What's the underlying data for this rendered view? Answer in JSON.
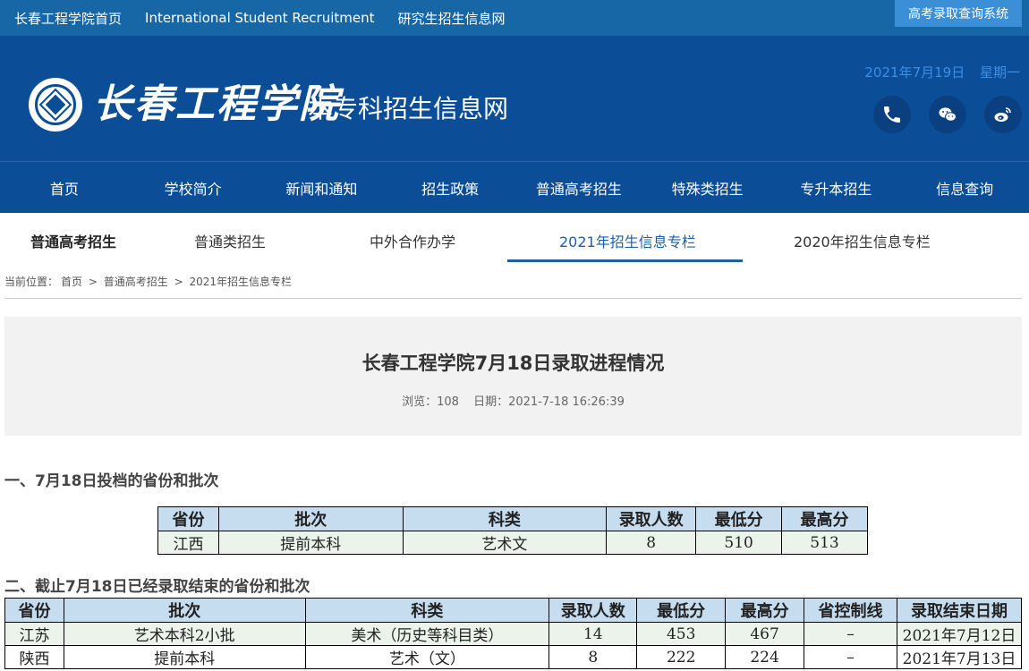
{
  "topbar": {
    "links": [
      "长春工程学院首页",
      "International Student Recruitment",
      "研究生招生信息网"
    ],
    "system_button": "高考录取查询系统"
  },
  "header": {
    "brand_calligraphy": "长春工程学院",
    "brand_sub": "本专科招生信息网",
    "date": "2021年7月19日",
    "weekday": "星期一",
    "social_icons": [
      "phone-icon",
      "wechat-icon",
      "weibo-icon"
    ]
  },
  "nav": [
    "首页",
    "学校简介",
    "新闻和通知",
    "招生政策",
    "普通高考招生",
    "特殊类招生",
    "专升本招生",
    "信息查询"
  ],
  "subnav": {
    "heading": "普通高考招生",
    "tabs": [
      "普通类招生",
      "中外合作办学",
      "2021年招生信息专栏",
      "2020年招生信息专栏"
    ],
    "active_index": 2
  },
  "breadcrumb": {
    "prefix": "当前位置：",
    "items": [
      "首页",
      "普通高考招生",
      "2021年招生信息专栏"
    ],
    "separator": ">"
  },
  "article": {
    "title": "长春工程学院7月18日录取进程情况",
    "views": "浏览：108",
    "date": "日期：2021-7-18 16:26:39"
  },
  "section1": {
    "heading": "一、7月18日投档的省份和批次",
    "columns": [
      "省份",
      "批次",
      "科类",
      "录取人数",
      "最低分",
      "最高分"
    ],
    "rows": [
      [
        "江西",
        "提前本科",
        "艺术文",
        "8",
        "510",
        "513"
      ]
    ]
  },
  "section2": {
    "heading": "二、截止7月18日已经录取结束的省份和批次",
    "columns": [
      "省份",
      "批次",
      "科类",
      "录取人数",
      "最低分",
      "最高分",
      "省控制线",
      "录取结束日期"
    ],
    "rows": [
      [
        "江苏",
        "艺术本科2小批",
        "美术（历史等科目类）",
        "14",
        "453",
        "467",
        "–",
        "2021年7月12日"
      ],
      [
        "陕西",
        "提前本科",
        "艺术（文）",
        "8",
        "222",
        "224",
        "–",
        "2021年7月13日"
      ]
    ]
  },
  "colors": {
    "topbar": "#1767a7",
    "header": "#0c4d97",
    "accent": "#1f5fa8",
    "table_header": "#c6dcef",
    "table_row": "#ebf3ea"
  }
}
